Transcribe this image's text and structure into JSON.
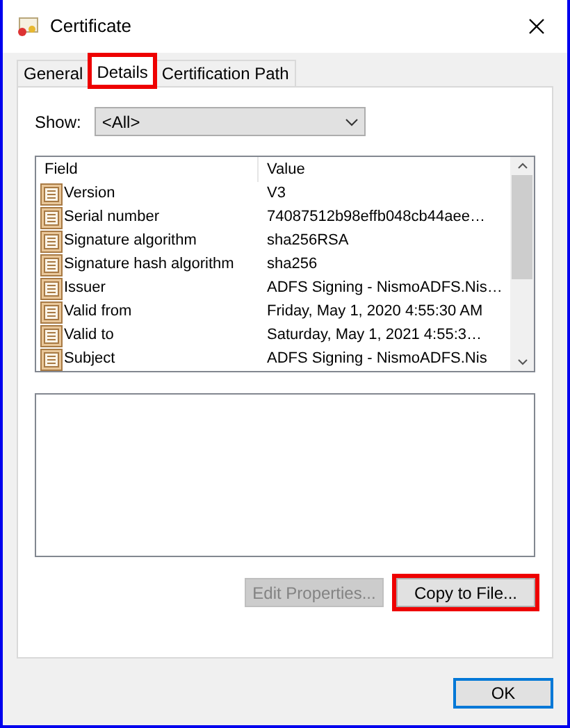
{
  "window": {
    "title": "Certificate"
  },
  "tabs": [
    {
      "label": "General",
      "selected": false,
      "highlighted": false
    },
    {
      "label": "Details",
      "selected": true,
      "highlighted": true
    },
    {
      "label": "Certification Path",
      "selected": false,
      "highlighted": false
    }
  ],
  "show": {
    "label": "Show:",
    "value": "<All>"
  },
  "table": {
    "columns": [
      "Field",
      "Value"
    ],
    "rows": [
      {
        "field": "Version",
        "value": "V3"
      },
      {
        "field": "Serial number",
        "value": "74087512b98effb048cb44aee…"
      },
      {
        "field": "Signature algorithm",
        "value": "sha256RSA"
      },
      {
        "field": "Signature hash algorithm",
        "value": "sha256"
      },
      {
        "field": "Issuer",
        "value": "ADFS Signing - NismoADFS.Nis…"
      },
      {
        "field": "Valid from",
        "value": "Friday, May 1, 2020 4:55:30 AM"
      },
      {
        "field": "Valid to",
        "value": "Saturday, May 1, 2021 4:55:3…"
      },
      {
        "field": "Subject",
        "value": "ADFS Signing - NismoADFS.Nis"
      }
    ]
  },
  "buttons": [
    {
      "label": "Edit Properties...",
      "disabled": true,
      "highlighted": false
    },
    {
      "label": "Copy to File...",
      "disabled": false,
      "highlighted": true
    }
  ],
  "footer_buttons": [
    {
      "label": "OK",
      "default": true
    }
  ]
}
